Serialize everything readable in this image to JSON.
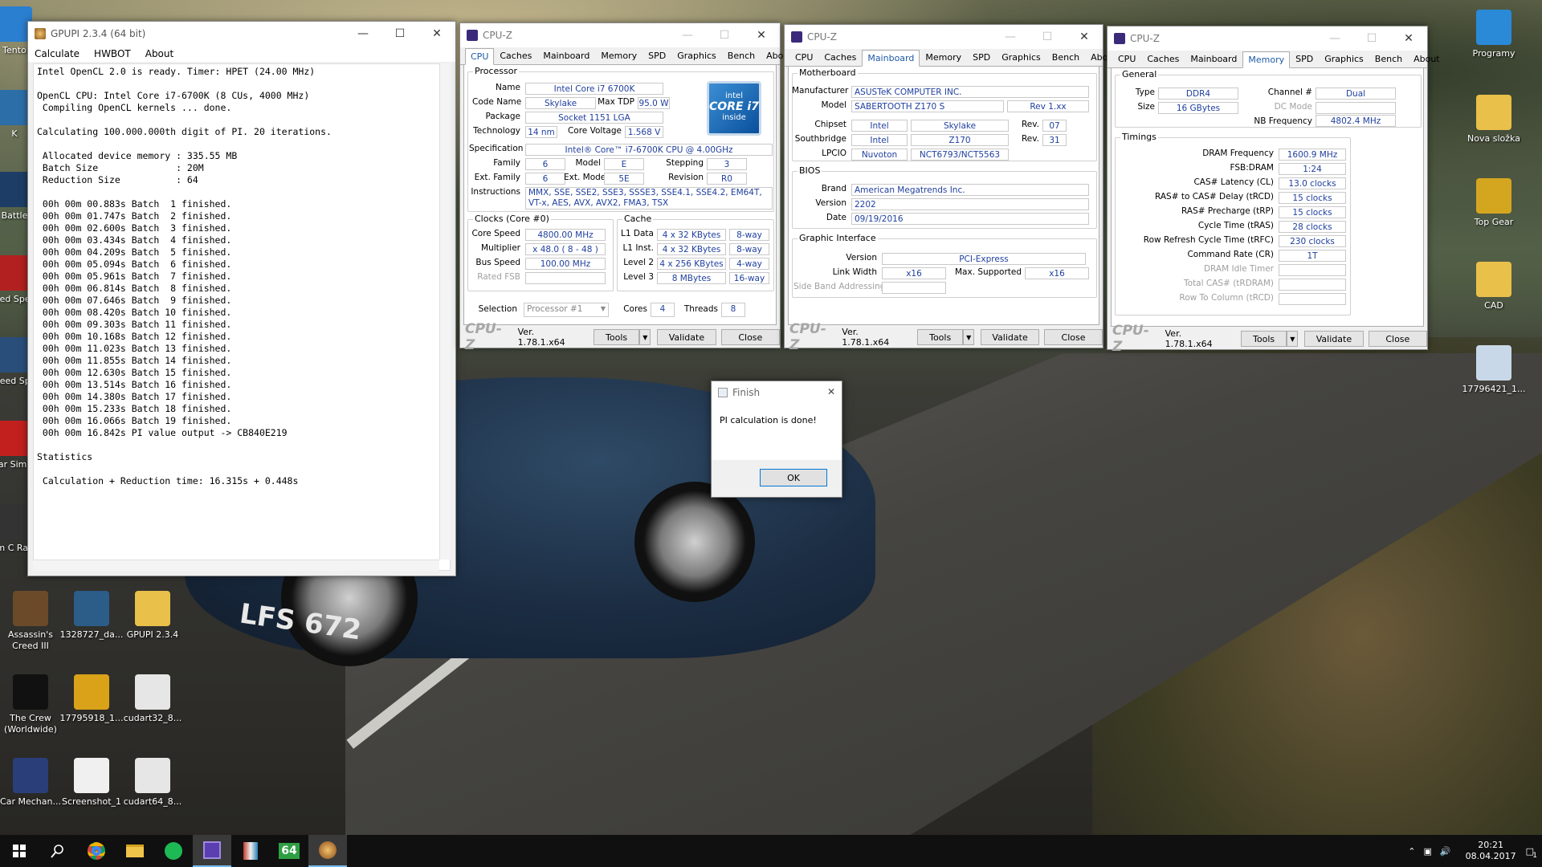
{
  "desktop": {
    "left_icons": [
      {
        "label": "Tento",
        "color": "#2a7fd0"
      },
      {
        "label": "K",
        "color": "#2c6ea8"
      },
      {
        "label": "Battle",
        "color": "#1e3d66"
      },
      {
        "label": "Need Speed",
        "color": "#b32020"
      },
      {
        "label": "Need Spe",
        "color": "#2a4e7a"
      },
      {
        "label": "Far Simul",
        "color": "#c21f1f"
      },
      {
        "label": "Tom C Rainb",
        "color": "#333"
      }
    ],
    "bottom_icons": [
      {
        "label": "Assassin's Creed III",
        "color": "#6b4a2a"
      },
      {
        "label": "1328727_da...",
        "color": "#2c5c88"
      },
      {
        "label": "GPUPI 2.3.4",
        "color": "#e8c04a"
      },
      {
        "label": "The Crew (Worldwide)",
        "color": "#111"
      },
      {
        "label": "17795918_1...",
        "color": "#d9a219"
      },
      {
        "label": "cudart32_8...",
        "color": "#e6e6e6"
      },
      {
        "label": "Car Mechan...",
        "color": "#2a3f7a"
      },
      {
        "label": "Screenshot_1",
        "color": "#f0f0f0"
      },
      {
        "label": "cudart64_8...",
        "color": "#e6e6e6"
      }
    ],
    "right_icons": [
      {
        "label": "Programy",
        "color": "#2a8ad8"
      },
      {
        "label": "Nova složka",
        "color": "#e8c04a"
      },
      {
        "label": "Top Gear",
        "color": "#d4a620"
      },
      {
        "label": "CAD",
        "color": "#e8c04a"
      },
      {
        "label": "17796421_1...",
        "color": "#c9d8e8"
      }
    ],
    "plate": "LFS 672"
  },
  "gpupi": {
    "title": "GPUPI 2.3.4 (64 bit)",
    "menu": [
      "Calculate",
      "HWBOT",
      "About"
    ],
    "lines": [
      "Intel OpenCL 2.0 is ready. Timer: HPET (24.00 MHz)",
      "",
      "OpenCL CPU: Intel Core i7-6700K (8 CUs, 4000 MHz)",
      " Compiling OpenCL kernels ... done.",
      "",
      "Calculating 100.000.000th digit of PI. 20 iterations.",
      "",
      " Allocated device memory : 335.55 MB",
      " Batch Size              : 20M",
      " Reduction Size          : 64",
      "",
      " 00h 00m 00.883s Batch  1 finished.",
      " 00h 00m 01.747s Batch  2 finished.",
      " 00h 00m 02.600s Batch  3 finished.",
      " 00h 00m 03.434s Batch  4 finished.",
      " 00h 00m 04.209s Batch  5 finished.",
      " 00h 00m 05.094s Batch  6 finished.",
      " 00h 00m 05.961s Batch  7 finished.",
      " 00h 00m 06.814s Batch  8 finished.",
      " 00h 00m 07.646s Batch  9 finished.",
      " 00h 00m 08.420s Batch 10 finished.",
      " 00h 00m 09.303s Batch 11 finished.",
      " 00h 00m 10.168s Batch 12 finished.",
      " 00h 00m 11.023s Batch 13 finished.",
      " 00h 00m 11.855s Batch 14 finished.",
      " 00h 00m 12.630s Batch 15 finished.",
      " 00h 00m 13.514s Batch 16 finished.",
      " 00h 00m 14.380s Batch 17 finished.",
      " 00h 00m 15.233s Batch 18 finished.",
      " 00h 00m 16.066s Batch 19 finished.",
      " 00h 00m 16.842s PI value output -> CB840E219",
      "",
      "Statistics",
      "",
      " Calculation + Reduction time: 16.315s + 0.448s"
    ]
  },
  "cpuz_tabs": [
    "CPU",
    "Caches",
    "Mainboard",
    "Memory",
    "SPD",
    "Graphics",
    "Bench",
    "About"
  ],
  "cpuz_common": {
    "title": "CPU-Z",
    "logo": "CPU-Z",
    "version": "Ver. 1.78.1.x64",
    "tools": "Tools",
    "validate": "Validate",
    "close": "Close"
  },
  "cpu": {
    "processor_group": "Processor",
    "name_lbl": "Name",
    "name": "Intel Core i7 6700K",
    "codename_lbl": "Code Name",
    "codename": "Skylake",
    "tdp_lbl": "Max TDP",
    "tdp": "95.0 W",
    "package_lbl": "Package",
    "package": "Socket 1151 LGA",
    "tech_lbl": "Technology",
    "tech": "14 nm",
    "voltage_lbl": "Core Voltage",
    "voltage": "1.568 V",
    "spec_lbl": "Specification",
    "spec": "Intel® Core™ i7-6700K CPU @ 4.00GHz",
    "family_lbl": "Family",
    "family": "6",
    "model_lbl": "Model",
    "model": "E",
    "stepping_lbl": "Stepping",
    "stepping": "3",
    "extfamily_lbl": "Ext. Family",
    "extfamily": "6",
    "extmodel_lbl": "Ext. Model",
    "extmodel": "5E",
    "revision_lbl": "Revision",
    "revision": "R0",
    "instr_lbl": "Instructions",
    "instr": "MMX, SSE, SSE2, SSE3, SSSE3, SSE4.1, SSE4.2, EM64T, VT-x, AES, AVX, AVX2, FMA3, TSX",
    "clocks_group": "Clocks (Core #0)",
    "corespeed_lbl": "Core Speed",
    "corespeed": "4800.00 MHz",
    "multiplier_lbl": "Multiplier",
    "multiplier": "x 48.0 ( 8 - 48 )",
    "busspeed_lbl": "Bus Speed",
    "busspeed": "100.00 MHz",
    "ratedfsb_lbl": "Rated FSB",
    "cache_group": "Cache",
    "l1d_lbl": "L1 Data",
    "l1d": "4 x 32 KBytes",
    "l1d_way": "8-way",
    "l1i_lbl": "L1 Inst.",
    "l1i": "4 x 32 KBytes",
    "l1i_way": "8-way",
    "l2_lbl": "Level 2",
    "l2": "4 x 256 KBytes",
    "l2_way": "4-way",
    "l3_lbl": "Level 3",
    "l3": "8 MBytes",
    "l3_way": "16-way",
    "selection_lbl": "Selection",
    "selection": "Processor #1",
    "cores_lbl": "Cores",
    "cores": "4",
    "threads_lbl": "Threads",
    "threads": "8",
    "badge_top": "intel",
    "badge_mid": "CORE i7",
    "badge_bot": "inside"
  },
  "mainboard": {
    "mb_group": "Motherboard",
    "manufacturer_lbl": "Manufacturer",
    "manufacturer": "ASUSTeK COMPUTER INC.",
    "model_lbl": "Model",
    "model": "SABERTOOTH Z170 S",
    "model_rev": "Rev 1.xx",
    "chipset_lbl": "Chipset",
    "chipset": "Intel",
    "chipset_name": "Skylake",
    "chipset_rev_lbl": "Rev.",
    "chipset_rev": "07",
    "southbridge_lbl": "Southbridge",
    "southbridge": "Intel",
    "southbridge_name": "Z170",
    "southbridge_rev_lbl": "Rev.",
    "southbridge_rev": "31",
    "lpcio_lbl": "LPCIO",
    "lpcio": "Nuvoton",
    "lpcio_name": "NCT6793/NCT5563",
    "bios_group": "BIOS",
    "brand_lbl": "Brand",
    "brand": "American Megatrends Inc.",
    "version_lbl": "Version",
    "version": "2202",
    "date_lbl": "Date",
    "date": "09/19/2016",
    "gi_group": "Graphic Interface",
    "giversion_lbl": "Version",
    "giversion": "PCI-Express",
    "linkwidth_lbl": "Link Width",
    "linkwidth": "x16",
    "maxsup_lbl": "Max. Supported",
    "maxsup": "x16",
    "sideband_lbl": "Side Band Addressing"
  },
  "memory": {
    "general_group": "General",
    "type_lbl": "Type",
    "type": "DDR4",
    "channel_lbl": "Channel #",
    "channel": "Dual",
    "size_lbl": "Size",
    "size": "16 GBytes",
    "dcmode_lbl": "DC Mode",
    "nbfreq_lbl": "NB Frequency",
    "nbfreq": "4802.4 MHz",
    "timings_group": "Timings",
    "rows": [
      {
        "label": "DRAM Frequency",
        "value": "1600.9 MHz",
        "dim": false
      },
      {
        "label": "FSB:DRAM",
        "value": "1:24",
        "dim": false
      },
      {
        "label": "CAS# Latency (CL)",
        "value": "13.0 clocks",
        "dim": false
      },
      {
        "label": "RAS# to CAS# Delay (tRCD)",
        "value": "15 clocks",
        "dim": false
      },
      {
        "label": "RAS# Precharge (tRP)",
        "value": "15 clocks",
        "dim": false
      },
      {
        "label": "Cycle Time (tRAS)",
        "value": "28 clocks",
        "dim": false
      },
      {
        "label": "Row Refresh Cycle Time (tRFC)",
        "value": "230 clocks",
        "dim": false
      },
      {
        "label": "Command Rate (CR)",
        "value": "1T",
        "dim": false
      },
      {
        "label": "DRAM Idle Timer",
        "value": "",
        "dim": true
      },
      {
        "label": "Total CAS# (tRDRAM)",
        "value": "",
        "dim": true
      },
      {
        "label": "Row To Column (tRCD)",
        "value": "",
        "dim": true
      }
    ]
  },
  "dialog": {
    "title": "Finish",
    "message": "PI calculation is done!",
    "ok": "OK"
  },
  "taskbar": {
    "time": "20:21",
    "date": "08.04.2017",
    "badge": "64",
    "notif_count": "1"
  }
}
